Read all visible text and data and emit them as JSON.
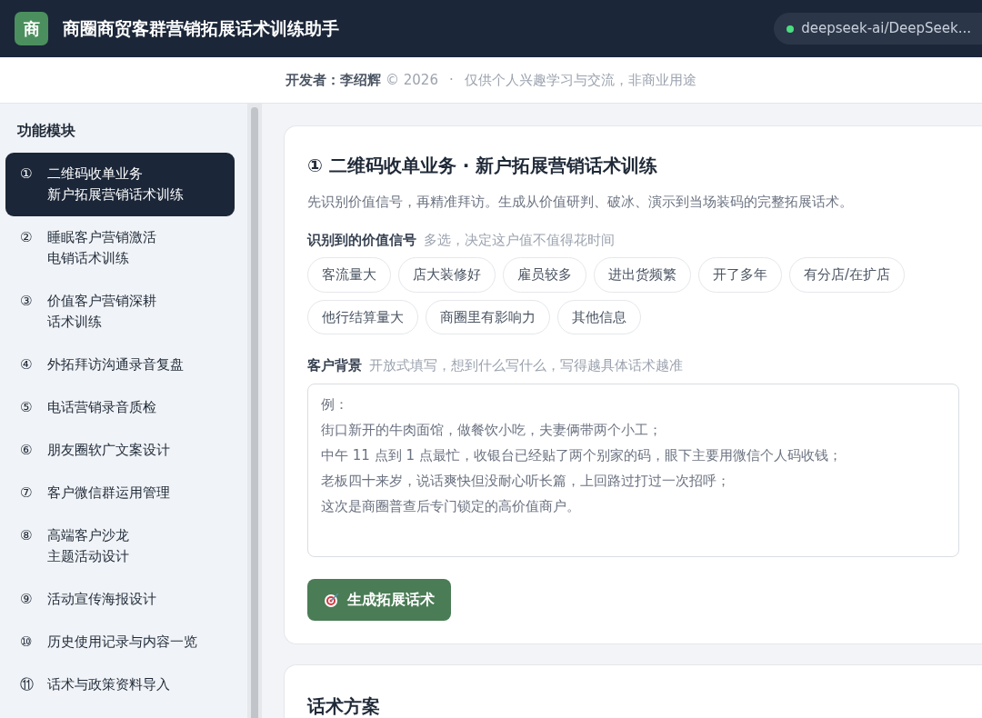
{
  "header": {
    "logo": "商",
    "title": "商圈商贸客群营销拓展话术训练助手",
    "model": {
      "label": "deepseek-ai/DeepSeek...",
      "online": true
    }
  },
  "credit": {
    "label": "开发者：",
    "name": "李绍辉",
    "copyright": "© 2026",
    "separator": "·",
    "note": "仅供个人兴趣学习与交流，非商业用途"
  },
  "sidebar": {
    "title": "功能模块",
    "items": [
      {
        "number": "①",
        "lines": [
          "二维码收单业务",
          "新户拓展营销话术训练"
        ],
        "selected": true
      },
      {
        "number": "②",
        "lines": [
          "睡眠客户营销激活",
          "电销话术训练"
        ],
        "selected": false
      },
      {
        "number": "③",
        "lines": [
          "价值客户营销深耕",
          "话术训练"
        ],
        "selected": false
      },
      {
        "number": "④",
        "lines": [
          "外拓拜访沟通录音复盘"
        ],
        "selected": false
      },
      {
        "number": "⑤",
        "lines": [
          "电话营销录音质检"
        ],
        "selected": false
      },
      {
        "number": "⑥",
        "lines": [
          "朋友圈软广文案设计"
        ],
        "selected": false
      },
      {
        "number": "⑦",
        "lines": [
          "客户微信群运用管理"
        ],
        "selected": false
      },
      {
        "number": "⑧",
        "lines": [
          "高端客户沙龙",
          "主题活动设计"
        ],
        "selected": false
      },
      {
        "number": "⑨",
        "lines": [
          "活动宣传海报设计"
        ],
        "selected": false
      },
      {
        "number": "⑩",
        "lines": [
          "历史使用记录与内容一览"
        ],
        "selected": false
      },
      {
        "number": "⑪",
        "lines": [
          "话术与政策资料导入"
        ],
        "selected": false
      }
    ]
  },
  "main": {
    "title": "① 二维码收单业务 · 新户拓展营销话术训练",
    "description": "先识别价值信号，再精准拜访。生成从价值研判、破冰、演示到当场装码的完整拓展话术。",
    "signals": {
      "label": "识别到的价值信号",
      "hint": "多选，决定这户值不值得花时间",
      "chips": [
        {
          "label": "客流量大",
          "selected": false
        },
        {
          "label": "店大装修好",
          "selected": false
        },
        {
          "label": "雇员较多",
          "selected": false
        },
        {
          "label": "进出货频繁",
          "selected": false
        },
        {
          "label": "开了多年",
          "selected": false
        },
        {
          "label": "有分店/在扩店",
          "selected": false
        },
        {
          "label": "他行结算量大",
          "selected": false
        },
        {
          "label": "商圈里有影响力",
          "selected": false
        },
        {
          "label": "其他信息",
          "selected": false
        }
      ]
    },
    "background": {
      "label": "客户背景",
      "hint": "开放式填写，想到什么写什么，写得越具体话术越准",
      "placeholder": [
        "例：",
        "街口新开的牛肉面馆，做餐饮小吃，夫妻俩带两个小工；",
        "中午 11 点到 1 点最忙，收银台已经贴了两个别家的码，眼下主要用微信个人码收钱；",
        "老板四十来岁，说话爽快但没耐心听长篇，上回路过打过一次招呼；",
        "这次是商圈普查后专门锁定的高价值商户。"
      ]
    },
    "button": "生成拓展话术"
  },
  "result": {
    "title": "话术方案"
  }
}
